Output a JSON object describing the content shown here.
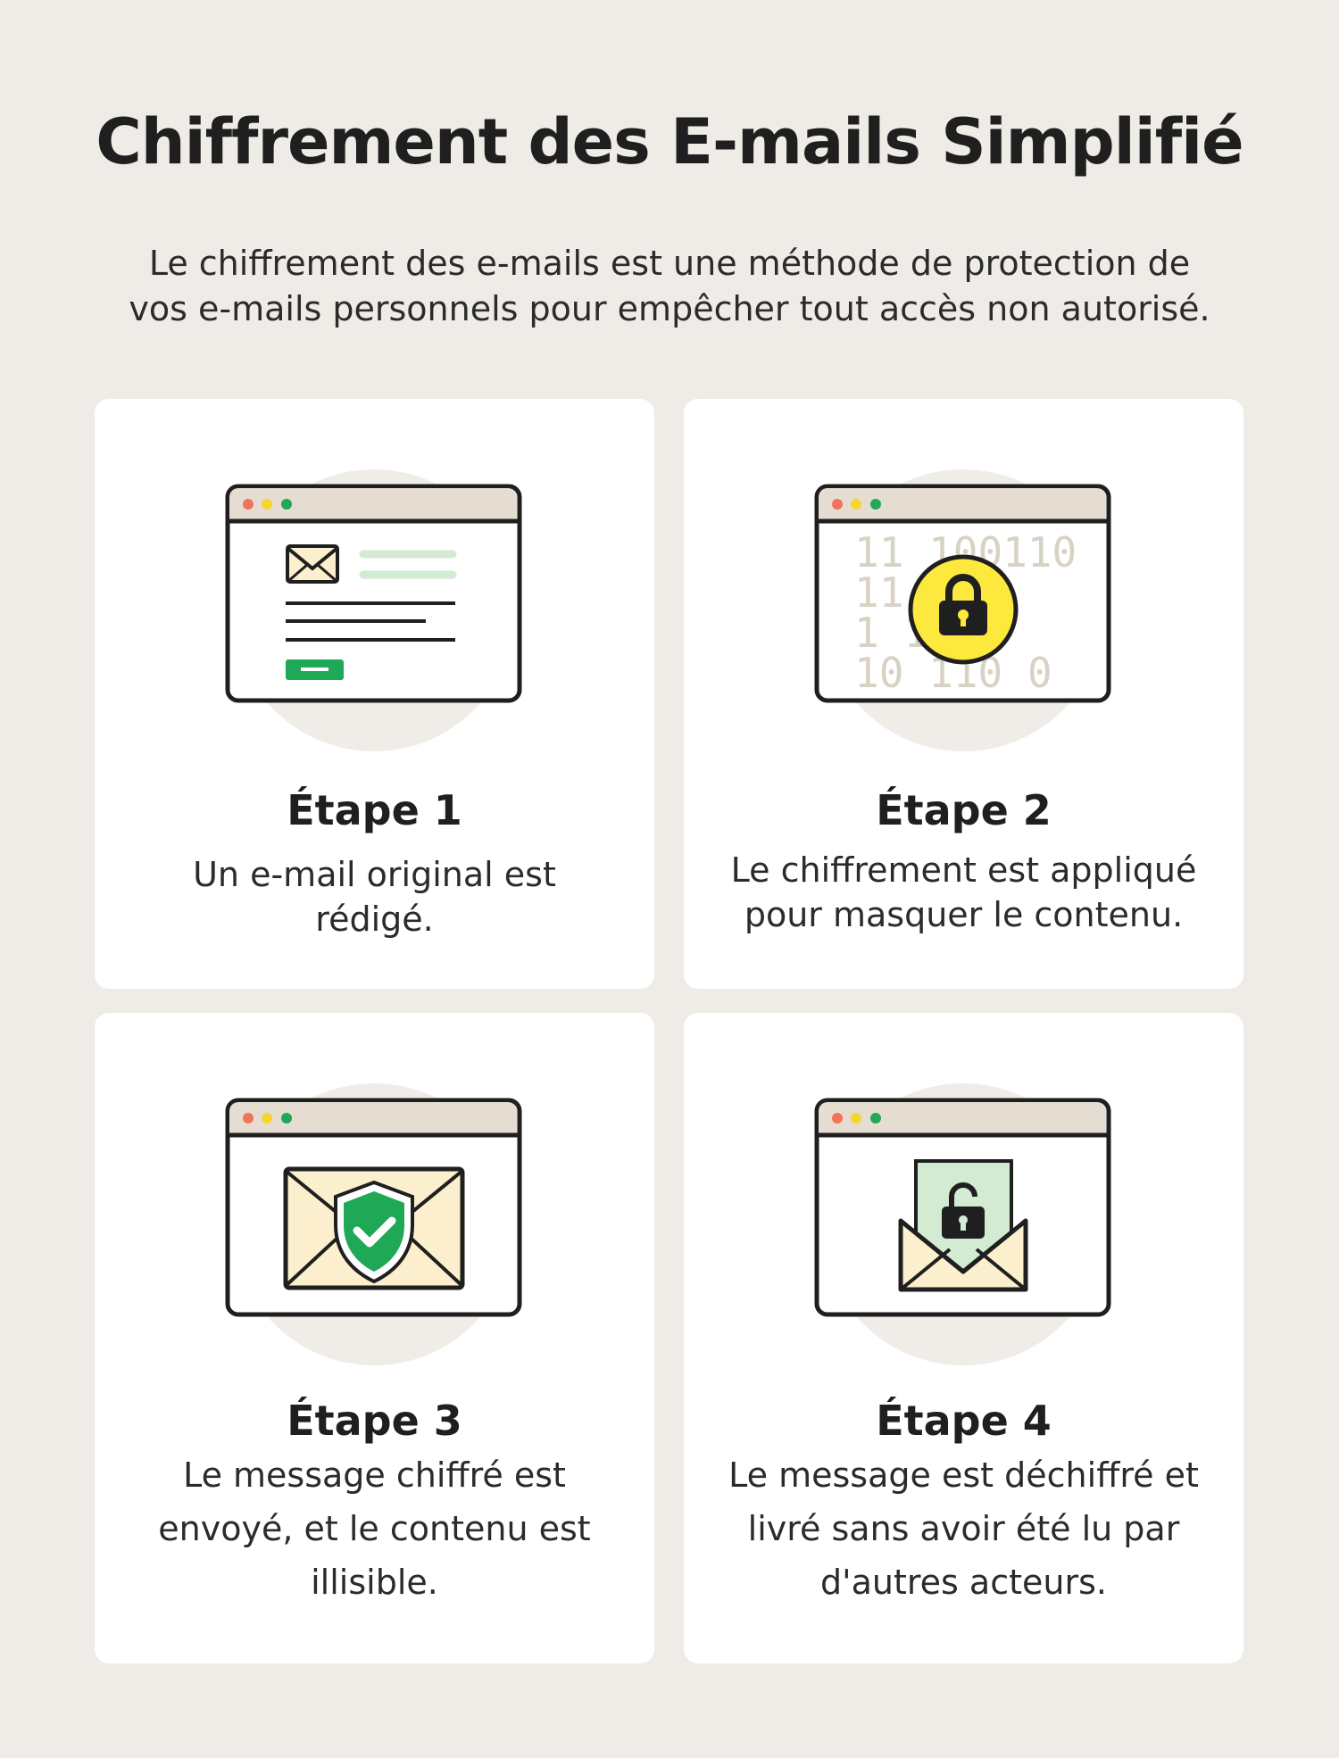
{
  "title": "Chiffrement des E-mails Simplifié",
  "subtitle": "Le chiffrement des e-mails est une méthode de protection de vos e-mails personnels pour empêcher tout accès non autorisé.",
  "steps": [
    {
      "title": "Étape 1",
      "text": "Un e-mail original est rédigé.",
      "icon": "email-draft-icon"
    },
    {
      "title": "Étape 2",
      "text": "Le chiffrement est appliqué pour masquer le contenu.",
      "icon": "padlock-icon"
    },
    {
      "title": "Étape 3",
      "text": "Le message chiffré est envoyé, et le contenu est illisible.",
      "icon": "shield-envelope-icon"
    },
    {
      "title": "Étape 4",
      "text": "Le message est déchiffré et livré sans avoir été lu par d'autres acteurs.",
      "icon": "unlocked-envelope-icon"
    }
  ],
  "binary_rows": [
    "11 100110",
    "11      0",
    "1       11",
    "10  110 0"
  ],
  "colors": {
    "background": "#efece7",
    "card": "#ffffff",
    "accent_green": "#1fa855",
    "accent_yellow": "#fde93d",
    "light_green": "#d3ead3",
    "envelope_cream": "#fbefcd",
    "window_bar": "#e5ddd2",
    "dot_red": "#f0735a",
    "dot_yellow": "#f6d52f",
    "dot_green": "#1fa855"
  }
}
